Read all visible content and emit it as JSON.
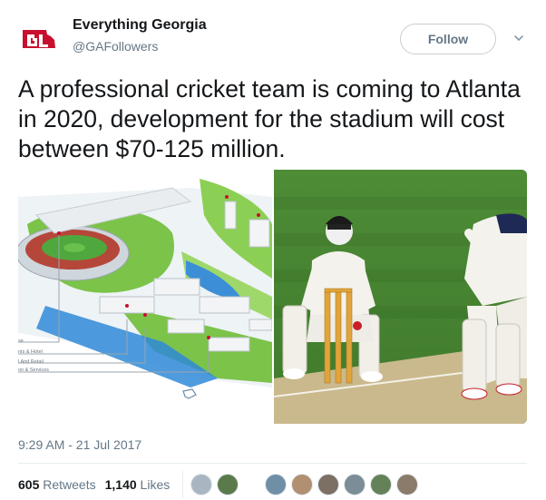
{
  "tweet": {
    "display_name": "Everything Georgia",
    "handle": "@GAFollowers",
    "follow_label": "Follow",
    "text": "A professional cricket team is coming to Atlanta in 2020, development for the stadium will cost between $70-125 million.",
    "timestamp": "9:29 AM - 21 Jul 2017",
    "retweets_count": "605",
    "retweets_label": "Retweets",
    "likes_count": "1,140",
    "likes_label": "Likes"
  },
  "media": {
    "left_legend": [
      "se",
      "nts & Hotel",
      "l And Retail",
      "on & Services"
    ]
  },
  "colors": {
    "brand_red": "#c8102e",
    "text_primary": "#14171a",
    "text_secondary": "#657786",
    "grass": "#4f8a3a"
  },
  "icons": [
    "georgia-logo-icon",
    "chevron-down-icon",
    "map-compass-icon"
  ],
  "likers": [
    "#a9b6c2",
    "#6f8fa6",
    "#7c6f63",
    "#b09070",
    "#5b7a4c",
    "#7b8d97",
    "#64825a",
    "#8a7b6a"
  ]
}
